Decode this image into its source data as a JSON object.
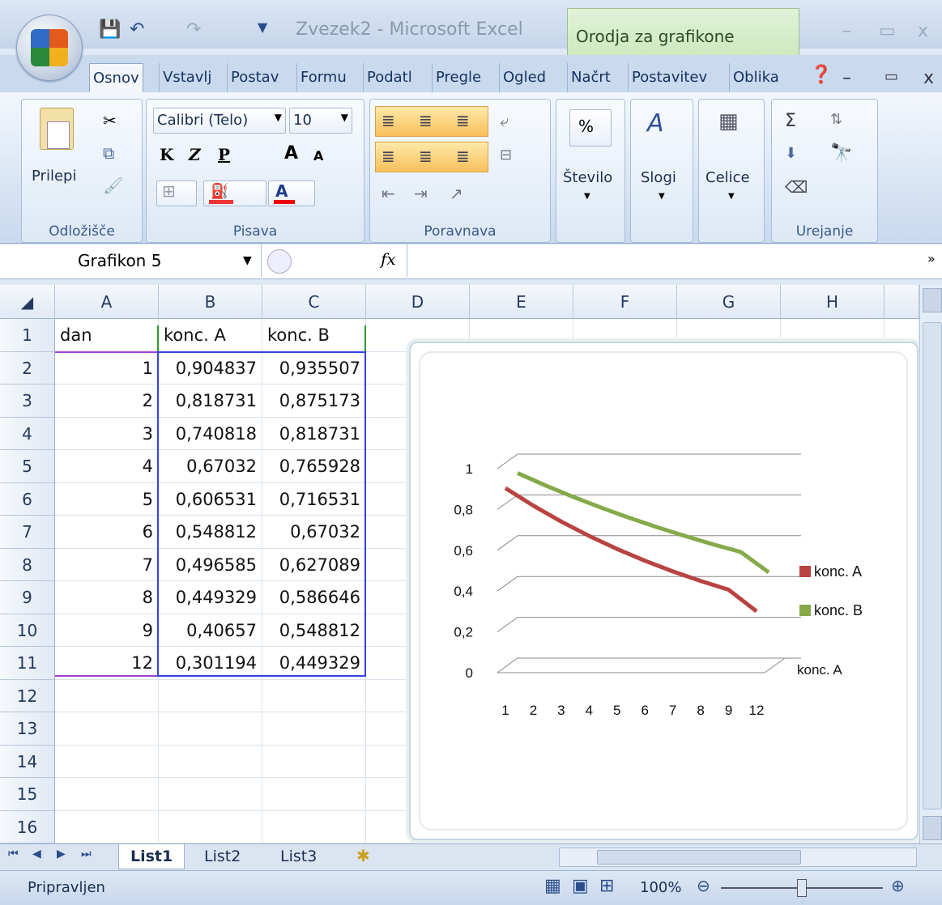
{
  "app": {
    "title": "Zvezek2 - Microsoft Excel",
    "context_tab": "Orodja za grafikone",
    "win_min": "–",
    "win_max": "▭",
    "win_close": "x"
  },
  "tabs": [
    "Osnov",
    "Vstavlj",
    "Postav",
    "Formu",
    "Podatl",
    "Pregle",
    "Ogled",
    "Načrt",
    "Postavitev",
    "Oblika"
  ],
  "ribbon": {
    "clipboard": {
      "label": "Odložišče",
      "paste": "Prilepi"
    },
    "font": {
      "label": "Pisava",
      "name": "Calibri (Telo)",
      "size": "10",
      "bold": "K",
      "italic": "Z",
      "underline": "P",
      "grow": "A",
      "shrink": "A",
      "font_color": "A"
    },
    "alignment": {
      "label": "Poravnava"
    },
    "number": {
      "label": "Število",
      "percent": "%"
    },
    "styles": {
      "label": "Slogi"
    },
    "cells": {
      "label": "Celice"
    },
    "editing": {
      "label": "Urejanje",
      "sum": "Σ"
    }
  },
  "formula_bar": {
    "name_box": "Grafikon 5",
    "fx": "fx",
    "value": ""
  },
  "columns": [
    "A",
    "B",
    "C",
    "D",
    "E",
    "F",
    "G",
    "H"
  ],
  "rows": [
    "1",
    "2",
    "3",
    "4",
    "5",
    "6",
    "7",
    "8",
    "9",
    "10",
    "11",
    "12",
    "13",
    "14",
    "15",
    "16"
  ],
  "cells": [
    [
      "dan",
      "konc. A",
      "konc. B"
    ],
    [
      "1",
      "0,904837",
      "0,935507"
    ],
    [
      "2",
      "0,818731",
      "0,875173"
    ],
    [
      "3",
      "0,740818",
      "0,818731"
    ],
    [
      "4",
      "0,67032",
      "0,765928"
    ],
    [
      "5",
      "0,606531",
      "0,716531"
    ],
    [
      "6",
      "0,548812",
      "0,67032"
    ],
    [
      "7",
      "0,496585",
      "0,627089"
    ],
    [
      "8",
      "0,449329",
      "0,586646"
    ],
    [
      "9",
      "0,40657",
      "0,548812"
    ],
    [
      "12",
      "0,301194",
      "0,449329"
    ]
  ],
  "sheets": [
    "List1",
    "List2",
    "List3"
  ],
  "status": {
    "text": "Pripravljen",
    "zoom": "100%"
  },
  "chart_data": {
    "type": "line",
    "categories": [
      "1",
      "2",
      "3",
      "4",
      "5",
      "6",
      "7",
      "8",
      "9",
      "12"
    ],
    "series": [
      {
        "name": "konc. A",
        "color": "#b84341",
        "values": [
          0.904837,
          0.818731,
          0.740818,
          0.67032,
          0.606531,
          0.548812,
          0.496585,
          0.449329,
          0.40657,
          0.301194
        ]
      },
      {
        "name": "konc. B",
        "color": "#86a94a",
        "values": [
          0.935507,
          0.875173,
          0.818731,
          0.765928,
          0.716531,
          0.67032,
          0.627089,
          0.586646,
          0.548812,
          0.449329
        ]
      }
    ],
    "y_ticks": [
      "0",
      "0,2",
      "0,4",
      "0,6",
      "0,8",
      "1"
    ],
    "depth_label": "konc. A",
    "ylim": [
      0,
      1
    ],
    "grid": true,
    "legend": "right"
  }
}
